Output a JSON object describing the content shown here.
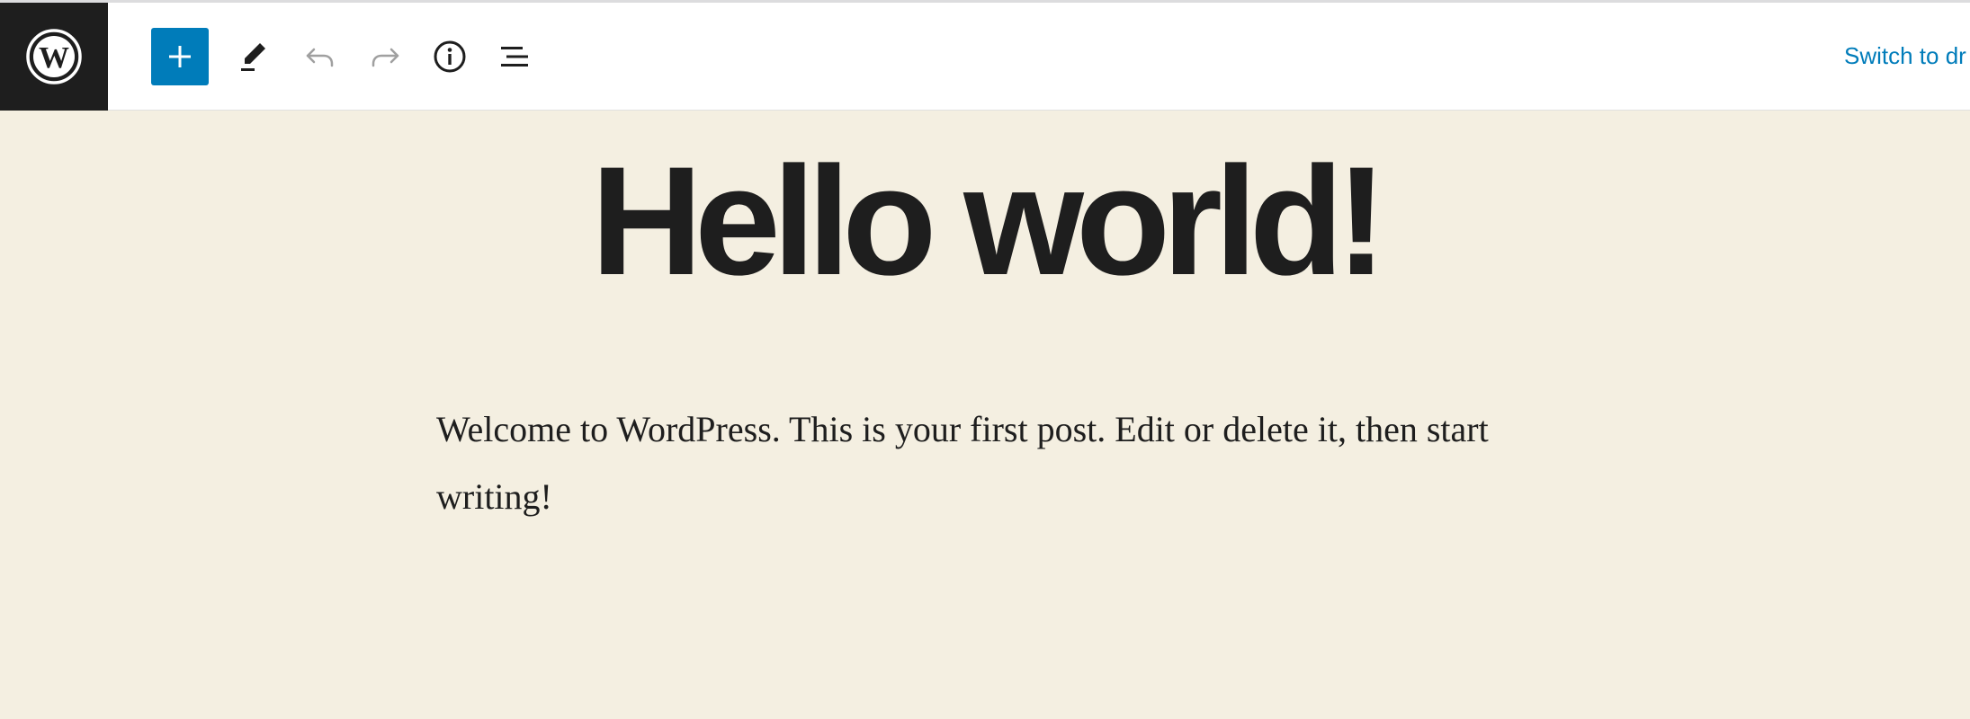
{
  "toolbar": {
    "logo_icon": "wordpress-logo-icon",
    "add_icon": "plus-icon",
    "edit_icon": "pencil-icon",
    "undo_icon": "undo-icon",
    "redo_icon": "redo-icon",
    "info_icon": "info-icon",
    "list_view_icon": "list-view-icon",
    "switch_to_draft_label": "Switch to dr"
  },
  "post": {
    "title": "Hello world!",
    "body": "Welcome to WordPress. This is your first post. Edit or delete it, then start writing!"
  },
  "colors": {
    "accent": "#007cba",
    "logo_bg": "#1e1e1e",
    "canvas_bg": "#f4efe1",
    "text": "#1e1e1e",
    "disabled_icon": "#a0a0a0"
  }
}
